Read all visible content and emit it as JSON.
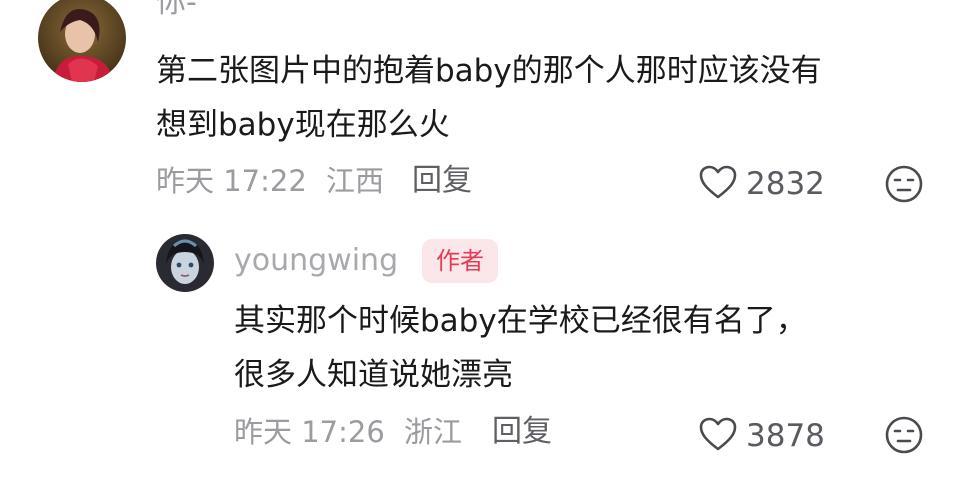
{
  "comments": [
    {
      "username": "你-",
      "text_lines": [
        "第二张图片中的抱着baby的那个人那时应该没有",
        "想到baby现在那么火"
      ],
      "time": "昨天 17:22",
      "location": "江西",
      "reply_label": "回复",
      "like_count": "2832"
    },
    {
      "username": "youngwing",
      "badge": "作者",
      "text_lines": [
        "其实那个时候baby在学校已经很有名了，",
        "很多人知道说她漂亮"
      ],
      "time": "昨天 17:26",
      "location": "浙江",
      "reply_label": "回复",
      "like_count": "3878"
    }
  ],
  "colors": {
    "badge_bg": "#fbe6ea",
    "badge_text": "#e33d54",
    "muted": "#9b9ba0"
  },
  "icons": {
    "like": "heart-outline-icon",
    "dislike": "neutral-face-icon"
  }
}
